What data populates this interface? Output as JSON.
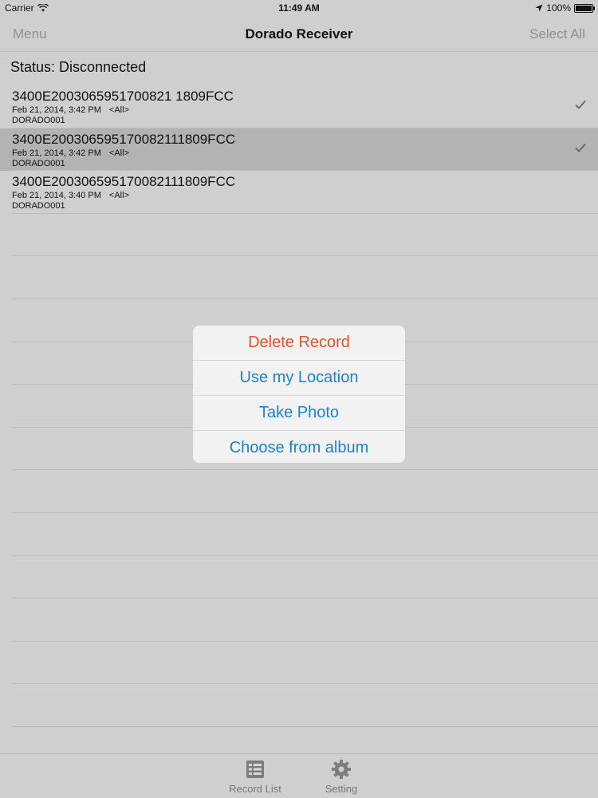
{
  "statusbar": {
    "carrier": "Carrier",
    "time": "11:49 AM",
    "battery": "100%"
  },
  "navbar": {
    "left_button": "Menu",
    "title": "Dorado Receiver",
    "right_button": "Select All"
  },
  "status": "Status: Disconnected",
  "records": [
    {
      "id": "3400E2003065951700821 1809FCC",
      "date": "Feb 21, 2014, 3:42 PM",
      "scope": "<All>",
      "device": "DORADO001",
      "checked": true,
      "selected": false
    },
    {
      "id": "3400E200306595170082111809FCC",
      "date": "Feb 21, 2014, 3:42 PM",
      "scope": "<All>",
      "device": "DORADO001",
      "checked": true,
      "selected": true
    },
    {
      "id": "3400E200306595170082111809FCC",
      "date": "Feb 21, 2014, 3:40 PM",
      "scope": "<All>",
      "device": "DORADO001",
      "checked": false,
      "selected": false
    }
  ],
  "action_sheet": {
    "delete": "Delete Record",
    "location": "Use my Location",
    "photo": "Take Photo",
    "album": "Choose from album"
  },
  "tabs": {
    "record_list": "Record List",
    "setting": "Setting"
  },
  "colors": {
    "accent": "#1d7fd6",
    "danger": "#e2532e",
    "selected_row": "#b3b3b3",
    "background": "#cfcfcf"
  },
  "icons": [
    "wifi-icon",
    "location-arrow-icon",
    "battery-icon",
    "checkmark-icon",
    "record-list-icon",
    "gear-icon"
  ]
}
